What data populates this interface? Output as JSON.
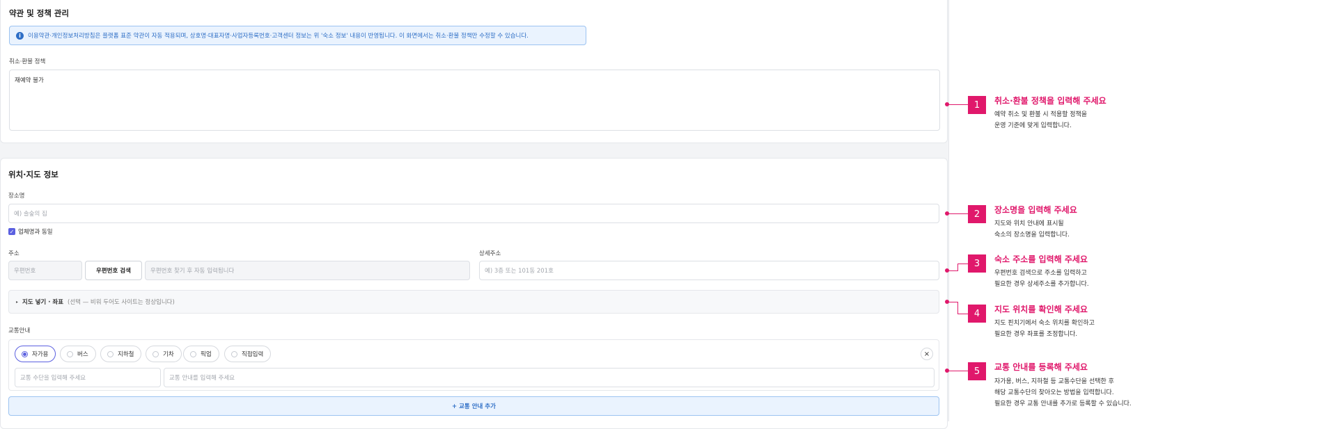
{
  "section1": {
    "title": "약관 및 정책 관리",
    "info_text": "이용약관·개인정보처리방침은 플랫폼 표준 약관이 자동 적용되며, 상호명·대표자명·사업자등록번호·고객센터 정보는 위 '숙소 정보' 내용이 반영됩니다. 이 화면에서는 취소·환불 정책만 수정할 수 있습니다.",
    "policy_label": "취소·환불 정책",
    "policy_value": "재예약 불가"
  },
  "section2": {
    "title": "위치·지도 정보",
    "place_label": "장소명",
    "place_placeholder": "예) 솔숲의 집",
    "same_as_business_label": "업체명과 동일",
    "same_as_business_checked": true,
    "address_label": "주소",
    "postcode_placeholder": "우편번호",
    "postcode_search_label": "우편번호 검색",
    "address_auto_placeholder": "우편번호 찾기 후 자동 입력됩니다",
    "detail_address_label": "상세주소",
    "detail_address_placeholder": "예) 3층 또는 101동 201호",
    "map_toggle_title": "지도 넣기 · 좌표",
    "map_toggle_sub": "(선택 — 비워 두어도 사이트는 정상입니다)",
    "transport_label": "교통안내",
    "transport_options": [
      "자가용",
      "버스",
      "지하철",
      "기차",
      "픽업",
      "직접입력"
    ],
    "transport_selected": "자가용",
    "transport_means_placeholder": "교통 수단을 입력해 주세요",
    "transport_guide_placeholder": "교통 안내를 입력해 주세요",
    "remove_label": "×",
    "add_transport_label": "+ 교통 안내 추가"
  },
  "guides": [
    {
      "number": "1",
      "title": "취소·환불 정책을 입력해 주세요",
      "lines": [
        "예약 취소 및 환불 시 적용할 정책을",
        "운영 기준에 맞게 입력합니다."
      ]
    },
    {
      "number": "2",
      "title": "장소명을 입력해 주세요",
      "lines": [
        "지도와 위치 안내에 표시될",
        "숙소의 장소명을 입력합니다."
      ]
    },
    {
      "number": "3",
      "title": "숙소 주소를 입력해 주세요",
      "lines": [
        "우편번호 검색으로 주소를 입력하고",
        "필요한 경우 상세주소를 추가합니다."
      ]
    },
    {
      "number": "4",
      "title": "지도 위치를 확인해 주세요",
      "lines": [
        "지도 핀치기에서 숙소 위치를 확인하고",
        "필요한 경우 좌표를 조정합니다."
      ]
    },
    {
      "number": "5",
      "title": "교통 안내를 등록해 주세요",
      "lines": [
        "자가용, 버스, 지하철 등 교통수단을 선택한 후",
        "해당 교통수단의 찾아오는 방법을 입력합니다.",
        "필요한 경우 교통 안내를 추가로 등록할 수 있습니다."
      ]
    }
  ],
  "colors": {
    "accent": "#e0186b",
    "primary": "#5b60e0",
    "info_blue": "#2f6fc6"
  }
}
